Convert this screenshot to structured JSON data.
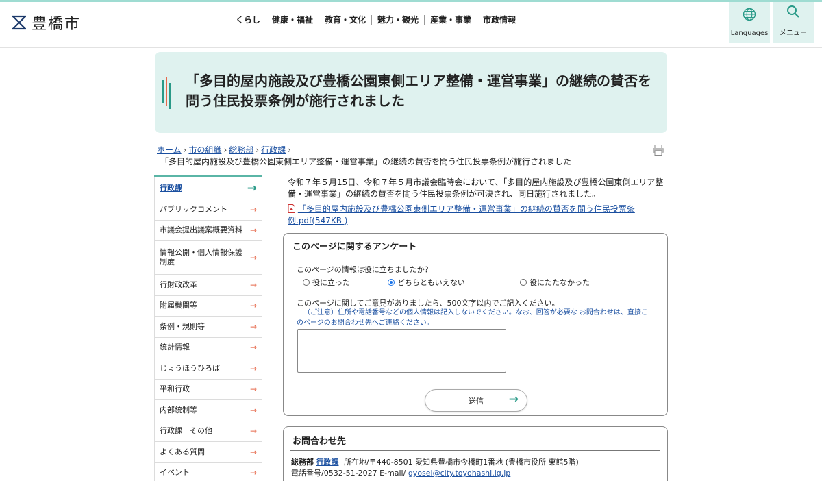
{
  "header": {
    "logo_text": "豊橋市",
    "nav": [
      "くらし",
      "健康・福祉",
      "教育・文化",
      "魅力・観光",
      "産業・事業",
      "市政情報"
    ],
    "languages_label": "Languages",
    "menu_label": "メニュー"
  },
  "page": {
    "title": "「多目的屋内施設及び豊橋公園東側エリア整備・運営事業」の継続の賛否を問う住民投票条例が施行されました"
  },
  "breadcrumb": {
    "items": [
      "ホーム",
      "市の組織",
      "総務部",
      "行政課"
    ],
    "current": "「多目的屋内施設及び豊橋公園東側エリア整備・運営事業」の継続の賛否を問う住民投票条例が施行されました"
  },
  "sidebar": {
    "items": [
      {
        "label": "行政課"
      },
      {
        "label": "パブリックコメント"
      },
      {
        "label": "市議会提出議案概要資料"
      },
      {
        "label": "情報公開・個人情報保護制度"
      },
      {
        "label": "行財政改革"
      },
      {
        "label": "附属機関等"
      },
      {
        "label": "条例・規則等"
      },
      {
        "label": "統計情報"
      },
      {
        "label": "じょうほうひろば"
      },
      {
        "label": "平和行政"
      },
      {
        "label": "内部統制等"
      },
      {
        "label": "行政課　その他"
      },
      {
        "label": "よくある質問"
      },
      {
        "label": "イベント"
      }
    ]
  },
  "content": {
    "body": "令和７年５月15日、令和７年５月市議会臨時会において、「多目的屋内施設及び豊橋公園東側エリア整備・運営事業」の継続の賛否を問う住民投票条例が可決され、同日施行されました。",
    "pdf_link": "「多目的屋内施設及び豊橋公園東側エリア整備・運営事業」の継続の賛否を問う住民投票条例.pdf(547KB )"
  },
  "survey": {
    "title": "このページに関するアンケート",
    "question1": "このページの情報は役に立ちましたか？",
    "options": [
      "役に立った",
      "どちらともいえない",
      "役にたたなかった"
    ],
    "selected_option": "どちらともいえない",
    "question2": "このページに関してご意見がありましたら、500文字以内でご記入ください。",
    "note": "（ご注意）住所や電話番号などの個人情報は記入しないでください。なお、回答が必要な お問合わせは、直接このページのお問合わせ先へご連絡ください。",
    "comment_value": "",
    "submit_label": "送信"
  },
  "contact": {
    "title": "お問合わせ先",
    "dept": "総務部",
    "section": "行政課",
    "address": "所在地/〒440-8501 愛知県豊橋市今橋町1番地 (豊橋市役所 東館5階)",
    "phone_label": "電話番号/0532-51-2027 E-mail/",
    "email": "gyosei@city.toyohashi.lg.jp"
  },
  "colors": {
    "accent": "#5ab5a6",
    "title_bg": "#dff2ef",
    "link": "#1a4fa0",
    "sidebar_arrow": "#e6684a"
  },
  "icons": [
    "logo-mark-icon",
    "globe-icon",
    "search-icon",
    "printer-icon",
    "pdf-icon",
    "arrow-right-icon"
  ]
}
